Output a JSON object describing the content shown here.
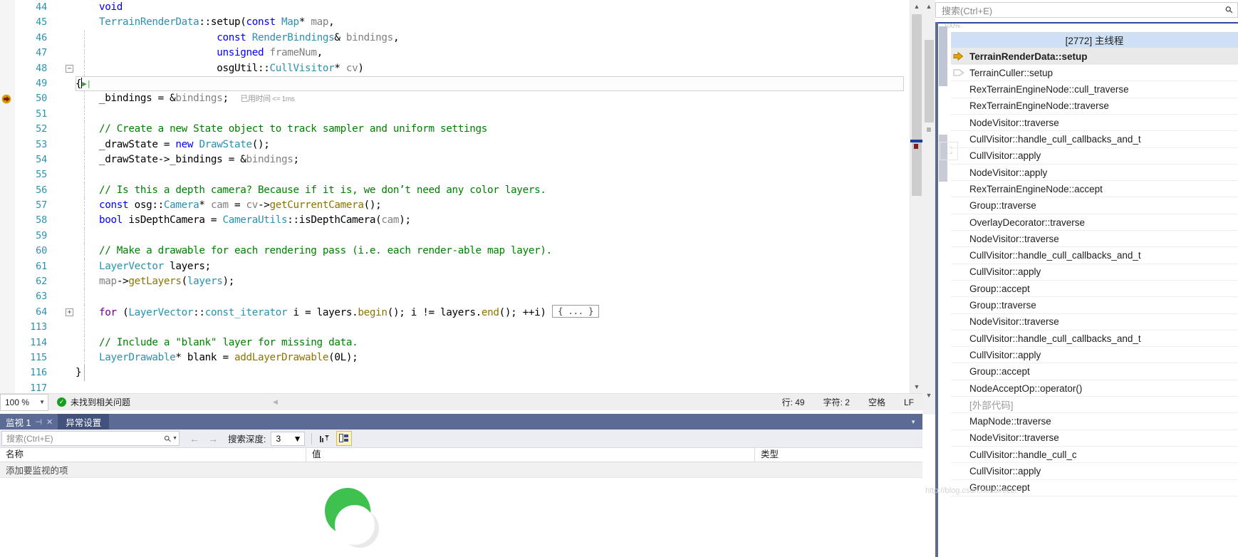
{
  "editor": {
    "lines": [
      {
        "num": "44",
        "indent": 1,
        "fold": "",
        "guide": "none",
        "tokens": [
          {
            "t": "    ",
            "c": "pl"
          },
          {
            "t": "void",
            "c": "k"
          }
        ]
      },
      {
        "num": "45",
        "indent": 1,
        "fold": "",
        "guide": "none",
        "tokens": [
          {
            "t": "    ",
            "c": "pl"
          },
          {
            "t": "TerrainRenderData",
            "c": "t"
          },
          {
            "t": "::setup(",
            "c": "pl"
          },
          {
            "t": "const",
            "c": "k"
          },
          {
            "t": " ",
            "c": "pl"
          },
          {
            "t": "Map",
            "c": "t"
          },
          {
            "t": "* ",
            "c": "pl"
          },
          {
            "t": "map",
            "c": "id"
          },
          {
            "t": ",",
            "c": "pl"
          }
        ]
      },
      {
        "num": "46",
        "indent": 1,
        "fold": "",
        "guide": "dashed",
        "tokens": [
          {
            "t": "                        ",
            "c": "pl"
          },
          {
            "t": "const",
            "c": "k"
          },
          {
            "t": " ",
            "c": "pl"
          },
          {
            "t": "RenderBindings",
            "c": "t"
          },
          {
            "t": "& ",
            "c": "pl"
          },
          {
            "t": "bindings",
            "c": "id"
          },
          {
            "t": ",",
            "c": "pl"
          }
        ]
      },
      {
        "num": "47",
        "indent": 1,
        "fold": "",
        "guide": "dashed",
        "tokens": [
          {
            "t": "                        ",
            "c": "pl"
          },
          {
            "t": "unsigned",
            "c": "k"
          },
          {
            "t": " ",
            "c": "pl"
          },
          {
            "t": "frameNum",
            "c": "id"
          },
          {
            "t": ",",
            "c": "pl"
          }
        ]
      },
      {
        "num": "48",
        "indent": 1,
        "fold": "minus",
        "guide": "dashed",
        "tokens": [
          {
            "t": "                        ",
            "c": "pl"
          },
          {
            "t": "osgUtil::",
            "c": "pl"
          },
          {
            "t": "CullVisitor",
            "c": "t"
          },
          {
            "t": "* ",
            "c": "pl"
          },
          {
            "t": "cv",
            "c": "id"
          },
          {
            "t": ")",
            "c": "pl"
          }
        ]
      },
      {
        "num": "49",
        "indent": 1,
        "fold": "",
        "guide": "none",
        "current": true,
        "tokens": [
          {
            "t": "{",
            "c": "pl"
          }
        ]
      },
      {
        "num": "50",
        "indent": 1,
        "fold": "",
        "guide": "dashed",
        "breakpoint": true,
        "elapsed": "已用时间",
        "elapsed_val": "<= 1ms",
        "tokens": [
          {
            "t": "    _bindings = &",
            "c": "pl"
          },
          {
            "t": "bindings",
            "c": "id"
          },
          {
            "t": ";",
            "c": "pl"
          }
        ]
      },
      {
        "num": "51",
        "indent": 1,
        "fold": "",
        "guide": "dashed",
        "tokens": []
      },
      {
        "num": "52",
        "indent": 1,
        "fold": "",
        "guide": "dashed",
        "tokens": [
          {
            "t": "    ",
            "c": "pl"
          },
          {
            "t": "// Create a new State object to track sampler and uniform settings",
            "c": "c"
          }
        ]
      },
      {
        "num": "53",
        "indent": 1,
        "fold": "",
        "guide": "dashed",
        "tokens": [
          {
            "t": "    _drawState = ",
            "c": "pl"
          },
          {
            "t": "new",
            "c": "k"
          },
          {
            "t": " ",
            "c": "pl"
          },
          {
            "t": "DrawState",
            "c": "t"
          },
          {
            "t": "();",
            "c": "pl"
          }
        ]
      },
      {
        "num": "54",
        "indent": 1,
        "fold": "",
        "guide": "dashed",
        "tokens": [
          {
            "t": "    _drawState->_bindings = &",
            "c": "pl"
          },
          {
            "t": "bindings",
            "c": "id"
          },
          {
            "t": ";",
            "c": "pl"
          }
        ]
      },
      {
        "num": "55",
        "indent": 1,
        "fold": "",
        "guide": "dashed",
        "tokens": []
      },
      {
        "num": "56",
        "indent": 1,
        "fold": "",
        "guide": "dashed",
        "tokens": [
          {
            "t": "    ",
            "c": "pl"
          },
          {
            "t": "// Is this a depth camera? Because if it is, we don’t need any color layers.",
            "c": "c"
          }
        ]
      },
      {
        "num": "57",
        "indent": 1,
        "fold": "",
        "guide": "dashed",
        "tokens": [
          {
            "t": "    ",
            "c": "pl"
          },
          {
            "t": "const",
            "c": "k"
          },
          {
            "t": " osg::",
            "c": "pl"
          },
          {
            "t": "Camera",
            "c": "t"
          },
          {
            "t": "* ",
            "c": "pl"
          },
          {
            "t": "cam",
            "c": "id"
          },
          {
            "t": " = ",
            "c": "pl"
          },
          {
            "t": "cv",
            "c": "id"
          },
          {
            "t": "->",
            "c": "pl"
          },
          {
            "t": "getCurrentCamera",
            "c": "fn"
          },
          {
            "t": "();",
            "c": "pl"
          }
        ]
      },
      {
        "num": "58",
        "indent": 1,
        "fold": "",
        "guide": "dashed",
        "tokens": [
          {
            "t": "    ",
            "c": "pl"
          },
          {
            "t": "bool",
            "c": "k"
          },
          {
            "t": " isDepthCamera = ",
            "c": "pl"
          },
          {
            "t": "CameraUtils",
            "c": "t"
          },
          {
            "t": "::isDepthCamera(",
            "c": "pl"
          },
          {
            "t": "cam",
            "c": "id"
          },
          {
            "t": ");",
            "c": "pl"
          }
        ]
      },
      {
        "num": "59",
        "indent": 1,
        "fold": "",
        "guide": "dashed",
        "tokens": []
      },
      {
        "num": "60",
        "indent": 1,
        "fold": "",
        "guide": "dashed",
        "tokens": [
          {
            "t": "    ",
            "c": "pl"
          },
          {
            "t": "// Make a drawable for each rendering pass (i.e. each render-able map layer).",
            "c": "c"
          }
        ]
      },
      {
        "num": "61",
        "indent": 1,
        "fold": "",
        "guide": "dashed",
        "tokens": [
          {
            "t": "    ",
            "c": "pl"
          },
          {
            "t": "LayerVector",
            "c": "t"
          },
          {
            "t": " layers;",
            "c": "pl"
          }
        ]
      },
      {
        "num": "62",
        "indent": 1,
        "fold": "",
        "guide": "dashed",
        "tokens": [
          {
            "t": "    ",
            "c": "pl"
          },
          {
            "t": "map",
            "c": "id"
          },
          {
            "t": "->",
            "c": "pl"
          },
          {
            "t": "getLayers",
            "c": "fn"
          },
          {
            "t": "(",
            "c": "pl"
          },
          {
            "t": "layers",
            "c": "t"
          },
          {
            "t": ");",
            "c": "pl"
          }
        ]
      },
      {
        "num": "63",
        "indent": 1,
        "fold": "",
        "guide": "dashed",
        "tokens": []
      },
      {
        "num": "64",
        "indent": 1,
        "fold": "plus",
        "guide": "dashed",
        "collapsed": "{ ... }",
        "tokens": [
          {
            "t": "    ",
            "c": "pl"
          },
          {
            "t": "for",
            "c": "p"
          },
          {
            "t": " (",
            "c": "pl"
          },
          {
            "t": "LayerVector",
            "c": "t"
          },
          {
            "t": "::",
            "c": "pl"
          },
          {
            "t": "const_iterator",
            "c": "t"
          },
          {
            "t": " i = ",
            "c": "pl"
          },
          {
            "t": "layers",
            "c": "pl"
          },
          {
            "t": ".",
            "c": "pl"
          },
          {
            "t": "begin",
            "c": "fn"
          },
          {
            "t": "(); i != ",
            "c": "pl"
          },
          {
            "t": "layers",
            "c": "pl"
          },
          {
            "t": ".",
            "c": "pl"
          },
          {
            "t": "end",
            "c": "fn"
          },
          {
            "t": "(); ++i)",
            "c": "pl"
          }
        ]
      },
      {
        "num": "113",
        "indent": 1,
        "fold": "",
        "guide": "dashed",
        "tokens": []
      },
      {
        "num": "114",
        "indent": 1,
        "fold": "",
        "guide": "dashed",
        "tokens": [
          {
            "t": "    ",
            "c": "pl"
          },
          {
            "t": "// Include a \"blank\" layer for missing data.",
            "c": "c"
          }
        ]
      },
      {
        "num": "115",
        "indent": 1,
        "fold": "",
        "guide": "dashed",
        "tokens": [
          {
            "t": "    ",
            "c": "pl"
          },
          {
            "t": "LayerDrawable",
            "c": "t"
          },
          {
            "t": "* blank = ",
            "c": "pl"
          },
          {
            "t": "addLayerDrawable",
            "c": "fn"
          },
          {
            "t": "(0L);",
            "c": "pl"
          }
        ]
      },
      {
        "num": "116",
        "indent": 1,
        "fold": "",
        "guide": "solid",
        "tokens": [
          {
            "t": "}",
            "c": "pl"
          }
        ]
      },
      {
        "num": "117",
        "indent": 1,
        "fold": "",
        "guide": "none",
        "tokens": []
      }
    ]
  },
  "editor_status": {
    "zoom": "100 %",
    "problems_text": "未找到相关问题",
    "line_label": "行: 49",
    "char_label": "字符: 2",
    "spaces_label": "空格",
    "eol_label": "LF"
  },
  "watch": {
    "tab_active": "监视 1",
    "tab_inactive": "异常设置",
    "search_placeholder": "搜索(Ctrl+E)",
    "depth_label": "搜索深度:",
    "depth_value": "3",
    "columns": [
      "名称",
      "值",
      "类型"
    ],
    "empty_row": "添加要监视的项"
  },
  "callstack": {
    "search_placeholder": "搜索(Ctrl+E)",
    "zoom_pct": "100%",
    "thread_label": "[2772] 主线程",
    "frames": [
      {
        "label": "TerrainRenderData::setup",
        "icon": "current-arrow-icon",
        "current": true
      },
      {
        "label": "TerrainCuller::setup",
        "icon": "hollow-arrow-icon"
      },
      {
        "label": "RexTerrainEngineNode::cull_traverse",
        "icon": ""
      },
      {
        "label": "RexTerrainEngineNode::traverse",
        "icon": ""
      },
      {
        "label": "NodeVisitor::traverse",
        "icon": ""
      },
      {
        "label": "CullVisitor::handle_cull_callbacks_and_t",
        "icon": ""
      },
      {
        "label": "CullVisitor::apply",
        "icon": ""
      },
      {
        "label": "NodeVisitor::apply",
        "icon": ""
      },
      {
        "label": "RexTerrainEngineNode::accept",
        "icon": ""
      },
      {
        "label": "Group::traverse",
        "icon": ""
      },
      {
        "label": "OverlayDecorator::traverse",
        "icon": ""
      },
      {
        "label": "NodeVisitor::traverse",
        "icon": ""
      },
      {
        "label": "CullVisitor::handle_cull_callbacks_and_t",
        "icon": ""
      },
      {
        "label": "CullVisitor::apply",
        "icon": ""
      },
      {
        "label": "Group::accept",
        "icon": ""
      },
      {
        "label": "Group::traverse",
        "icon": ""
      },
      {
        "label": "NodeVisitor::traverse",
        "icon": ""
      },
      {
        "label": "CullVisitor::handle_cull_callbacks_and_t",
        "icon": ""
      },
      {
        "label": "CullVisitor::apply",
        "icon": ""
      },
      {
        "label": "Group::accept",
        "icon": ""
      },
      {
        "label": "NodeAcceptOp::operator()",
        "icon": ""
      },
      {
        "label": "[外部代码]",
        "icon": "",
        "external": true
      },
      {
        "label": "MapNode::traverse",
        "icon": ""
      },
      {
        "label": "NodeVisitor::traverse",
        "icon": ""
      },
      {
        "label": "CullVisitor::handle_cull_c",
        "icon": ""
      },
      {
        "label": "CullVisitor::apply",
        "icon": ""
      },
      {
        "label": "Group::accept",
        "icon": ""
      }
    ]
  },
  "watermark": {
    "url": "http://blog.csdn.net/directx"
  },
  "colors": {
    "accent_blue": "#5c6b96",
    "tab_dark": "#43517d",
    "thread_row": "#cfe0f4",
    "keyword": "#0000ff",
    "type": "#2b91af",
    "comment": "#008000"
  }
}
